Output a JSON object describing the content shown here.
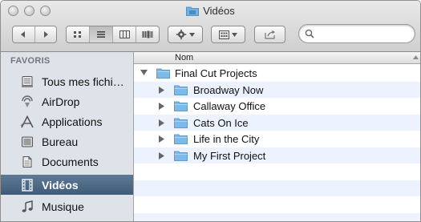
{
  "window": {
    "title": "Vidéos"
  },
  "toolbar": {
    "back_icon": "back-arrow-icon",
    "forward_icon": "forward-arrow-icon",
    "view_modes": [
      "icon-view",
      "list-view",
      "column-view",
      "coverflow-view"
    ],
    "action_icon": "gear-icon",
    "arrange_icon": "arrange-icon",
    "share_icon": "share-icon"
  },
  "search": {
    "value": "",
    "placeholder": ""
  },
  "sidebar": {
    "heading": "FAVORIS",
    "items": [
      {
        "label": "Tous mes fichi…",
        "icon": "all-files-icon"
      },
      {
        "label": "AirDrop",
        "icon": "airdrop-icon"
      },
      {
        "label": "Applications",
        "icon": "applications-icon"
      },
      {
        "label": "Bureau",
        "icon": "desktop-icon"
      },
      {
        "label": "Documents",
        "icon": "documents-icon"
      },
      {
        "label": "Vidéos",
        "icon": "movies-icon",
        "selected": true
      },
      {
        "label": "Musique",
        "icon": "music-icon"
      }
    ]
  },
  "list": {
    "column_name": "Nom",
    "rows": [
      {
        "name": "Final Cut Projects",
        "level": 0,
        "expanded": true
      },
      {
        "name": "Broadway Now",
        "level": 1,
        "expanded": false
      },
      {
        "name": "Callaway Office",
        "level": 1,
        "expanded": false
      },
      {
        "name": "Cats On Ice",
        "level": 1,
        "expanded": false
      },
      {
        "name": "Life in the City",
        "level": 1,
        "expanded": false
      },
      {
        "name": "My First Project",
        "level": 1,
        "expanded": false
      }
    ]
  },
  "colors": {
    "selection": "#4f6a88",
    "sidebar_bg": "#dee3ea",
    "alt_row": "#edf3fe",
    "folder_blue": "#6fb3e6"
  }
}
